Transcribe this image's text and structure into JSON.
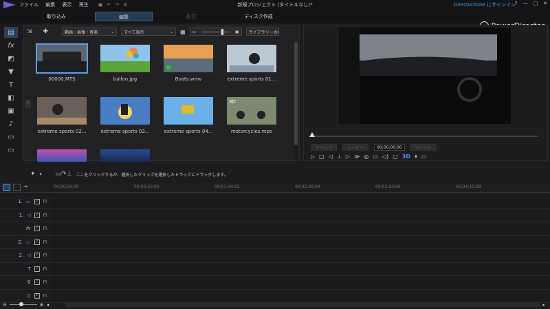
{
  "menu": {
    "items": [
      "ファイル",
      "編集",
      "表示",
      "再生"
    ]
  },
  "window": {
    "title": "新規プロジェクト (タイトルなし)*",
    "directorzone": "DirectorZone にサインイン",
    "controls": [
      "?",
      "—",
      "□",
      "✕"
    ]
  },
  "tabs": [
    {
      "label": "取り込み"
    },
    {
      "label": "編集"
    },
    {
      "label": "出力"
    },
    {
      "label": "ディスク作成"
    }
  ],
  "brand": "PowerDirector",
  "library": {
    "filter": "動画・画像・音楽",
    "display": "すべて表示",
    "search_placeholder": "ライブラリーの検索",
    "items": [
      {
        "name": "00000.MTS"
      },
      {
        "name": "ballon.jpg"
      },
      {
        "name": "Boats.wmv"
      },
      {
        "name": "extreme sports 01..."
      },
      {
        "name": "extreme sports 02..."
      },
      {
        "name": "extreme sports 03..."
      },
      {
        "name": "extreme sports 04..."
      },
      {
        "name": "motorcycles.mpo"
      }
    ]
  },
  "preview": {
    "clip_label": "クリップ",
    "movie_label": "ムービー",
    "timecode": "00;00;00;00",
    "fit": "フィット",
    "threed": "3D"
  },
  "timeline": {
    "hint": "ここをクリックするか、選択したクリップを選択したトラックにドラッグします。",
    "ruler": [
      "00;00;00;00",
      "00;00;50;00",
      "00;01;40;02",
      "00;02;30;04",
      "00;03;20;06",
      "00;04;10;08"
    ],
    "tracks": [
      {
        "label": "1.",
        "icon": "video-icon"
      },
      {
        "label": "1.",
        "icon": "audio-icon"
      },
      {
        "label": "fx",
        "icon": "fx-icon"
      },
      {
        "label": "2.",
        "icon": "video-icon"
      },
      {
        "label": "2.",
        "icon": "audio-icon"
      },
      {
        "label": "T",
        "icon": "title-icon"
      },
      {
        "label": "",
        "icon": "mic-icon"
      },
      {
        "label": "",
        "icon": "music-icon"
      }
    ]
  },
  "colors": {
    "accent": "#3f9ff0",
    "selected_tab": "#283a52"
  }
}
